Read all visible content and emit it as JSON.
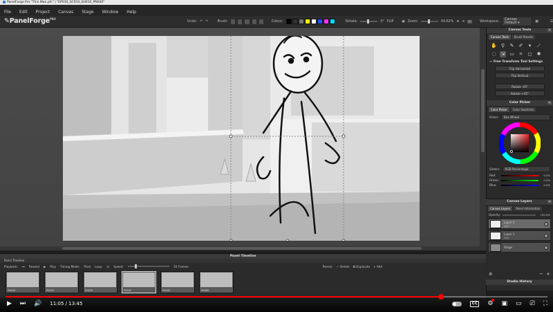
{
  "window": {
    "title": "PanelForge Pro \"Thin Man.pfc\" | \"EP010_SC010_SH010_PN040\""
  },
  "menu": [
    "File",
    "Edit",
    "Project",
    "Canvas",
    "Stage",
    "Window",
    "Help"
  ],
  "toolbar": {
    "brand": "PanelForge",
    "brand_sup": "PRO",
    "undo_label": "Undo:",
    "brush_label": "Brush:",
    "colour_label": "Colour:",
    "colour_swatches": [
      "#000000",
      "#333333",
      "#777777",
      "#ffff00",
      "#ffffff",
      "#2255ff",
      "#ff33ff",
      "#00ddff"
    ],
    "rotate_label": "Rotate:",
    "rotate_value": "0°",
    "flip_label": "FLIP",
    "zoom_label": "Zoom:",
    "zoom_value": "64.62%",
    "workspace_label": "Workspace:",
    "workspace_value": "Canvas Default"
  },
  "canvas_tools": {
    "title": "Canvas Tools",
    "tabs": [
      "Canvas Tools",
      "Brush Presets"
    ],
    "tools": [
      "hand-icon",
      "zoom-icon",
      "pencil-icon",
      "brush-icon",
      "bucket-icon",
      "eyedropper-icon",
      "lasso-icon",
      "transform-icon",
      "rect-select-icon",
      "crop-icon",
      "speech-bubble-icon",
      "star-icon"
    ],
    "section": "Free Transform Tool Settings",
    "buttons": [
      "Flip Horizontal",
      "Flip Vertical",
      "Rotate -45°",
      "Rotate +45°"
    ]
  },
  "color_picker": {
    "title": "Color Picker",
    "tabs": [
      "Color Picker",
      "Color Swatches"
    ],
    "picker_label": "Picker:",
    "picker_value": "Box Wheel",
    "sliders_label": "Sliders:",
    "sliders_value": "RGB Percentage",
    "channels": [
      {
        "name": "Red:",
        "value": "0.0%",
        "color": "#cc2222"
      },
      {
        "name": "Green:",
        "value": "0.0%",
        "color": "#22aa22"
      },
      {
        "name": "Blue:",
        "value": "0.0%",
        "color": "#2244dd"
      }
    ]
  },
  "canvas_layers": {
    "title": "Canvas Layers",
    "tabs": [
      "Canvas Layers",
      "Panel Information"
    ],
    "opacity_label": "Opacity:",
    "opacity_value": "100.0%",
    "layers": [
      {
        "name": "Layer 2",
        "sub": "vuln",
        "active": true
      },
      {
        "name": "Layer 1",
        "sub": "vuln",
        "active": false
      },
      {
        "name": "Stage",
        "sub": "",
        "active": false
      }
    ]
  },
  "timeline": {
    "title": "Panel Timeline",
    "tab": "Panel Timeline",
    "playback_label": "Playback:",
    "rewind_label": "Rewind",
    "play_label": "Play",
    "timing_label": "Timing Mode:",
    "timing_value": "Pixel",
    "loop_label": "Loop:",
    "speed_label": "Speed:",
    "speed_value": "10 Frames",
    "right_controls": [
      "Panels:",
      "Delete",
      "Duplicate",
      "Add"
    ],
    "frames": [
      {
        "label": "PN010"
      },
      {
        "label": "PN020"
      },
      {
        "label": "PN030"
      },
      {
        "label": "PN040"
      },
      {
        "label": "PN050"
      },
      {
        "label": "PN060"
      }
    ]
  },
  "studio_history": "Studio History",
  "video": {
    "current_time": "11:05",
    "total_time": "13:45",
    "progress": 0.804
  }
}
